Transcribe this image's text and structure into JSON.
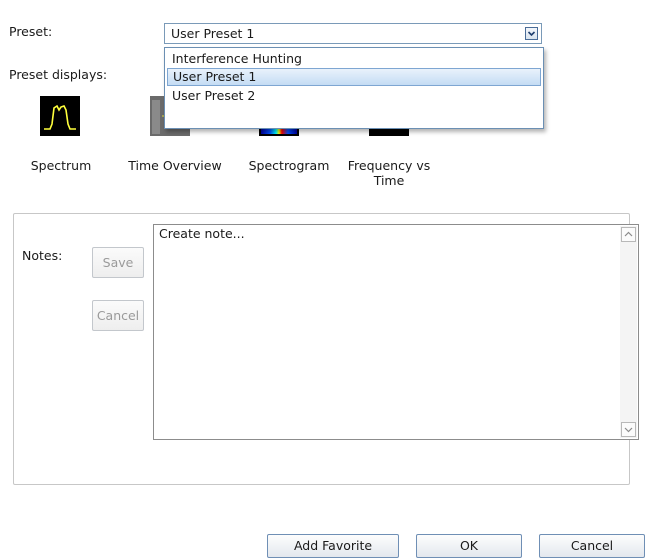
{
  "preset": {
    "label": "Preset:",
    "selected_value": "User Preset 1",
    "options": [
      "Interference Hunting",
      "User Preset 1",
      "User Preset 2"
    ]
  },
  "preset_displays": {
    "label": "Preset displays:",
    "items": [
      {
        "label": "Spectrum",
        "icon": "spectrum-icon"
      },
      {
        "label": "Time Overview",
        "icon": "time-overview-icon"
      },
      {
        "label": "Spectrogram",
        "icon": "spectrogram-icon"
      },
      {
        "label": "Frequency vs Time",
        "label_line1": "Frequency vs",
        "label_line2": "Time",
        "icon": "frequency-vs-time-icon"
      }
    ]
  },
  "notes": {
    "label": "Notes:",
    "save_label": "Save",
    "cancel_label": "Cancel",
    "text": "Create note..."
  },
  "footer": {
    "add_favorite_label": "Add Favorite",
    "ok_label": "OK",
    "cancel_label": "Cancel"
  },
  "colors": {
    "trace_yellow": "#ffff3c",
    "selection_blue": "#c4dcf4",
    "border_blue": "#6f8fb5"
  }
}
